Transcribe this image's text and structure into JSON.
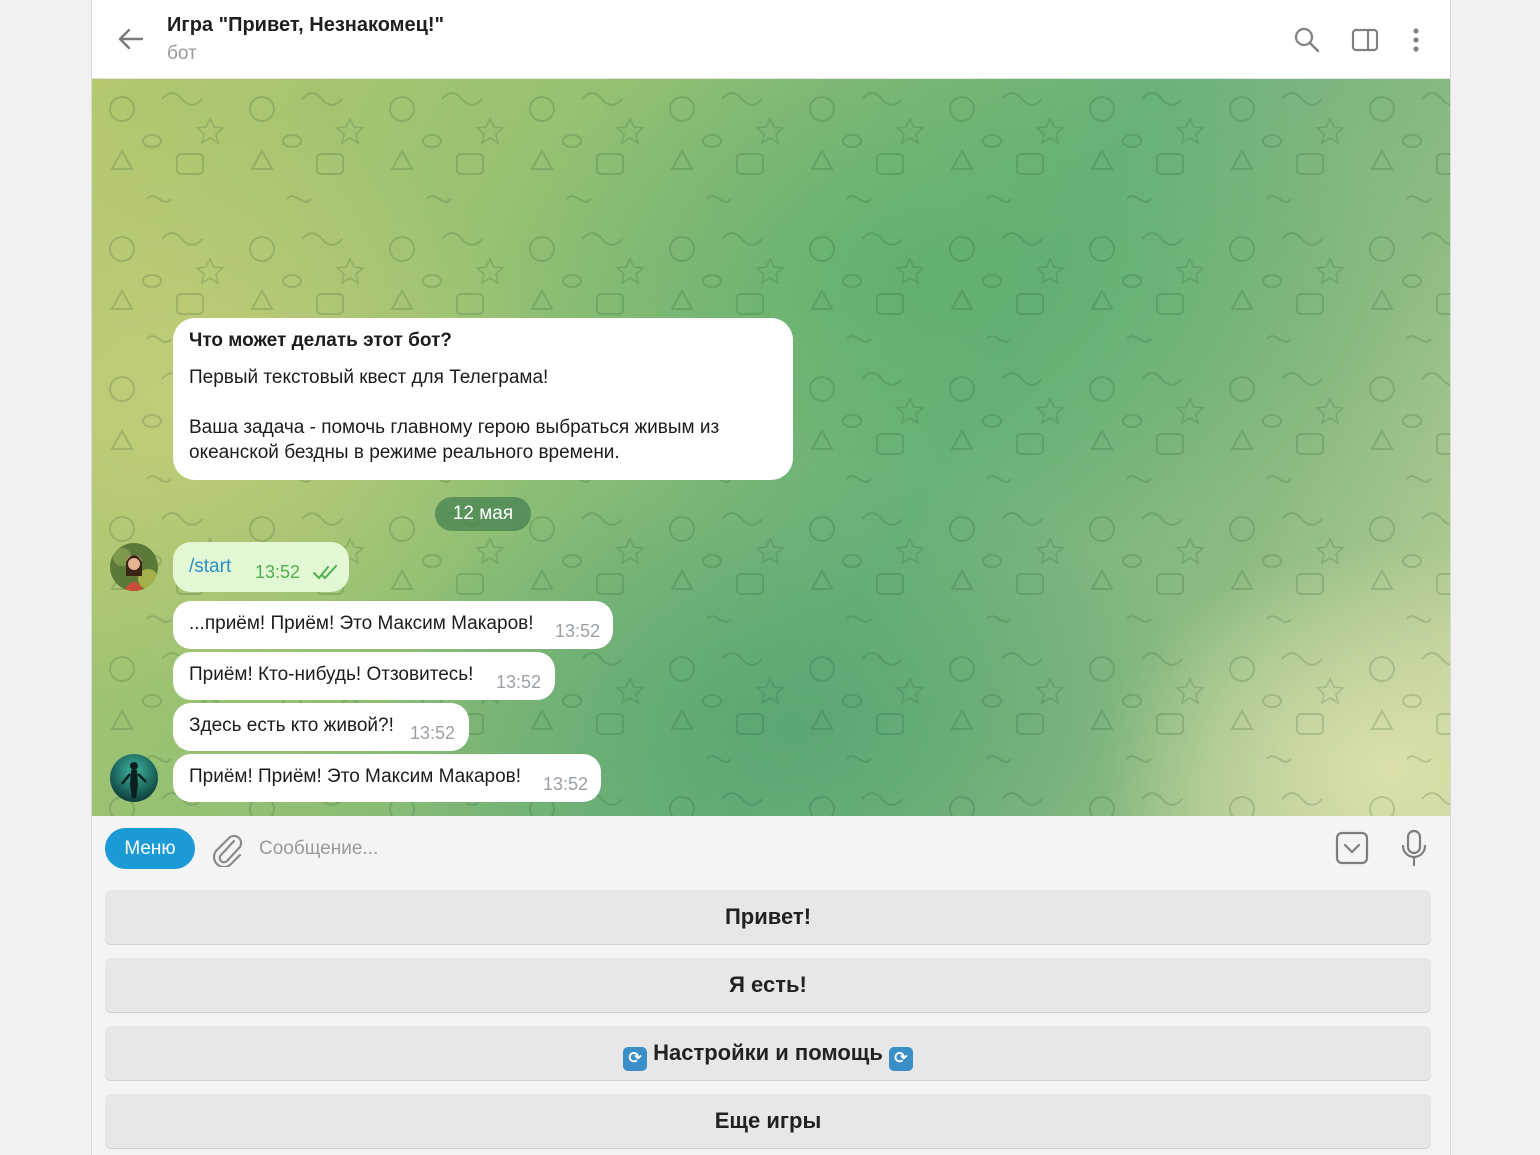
{
  "header": {
    "title": "Игра \"Привет, Незнакомец!\"",
    "subtitle": "бот"
  },
  "chat": {
    "info": {
      "question": "Что может делать этот бот?",
      "line1": "Первый текстовый квест для Телеграма!",
      "line2": "Ваша задача - помочь главному герою выбраться живым из океанской бездны в режиме реального времени."
    },
    "date": "12 мая",
    "outgoing": {
      "text": "/start",
      "time": "13:52"
    },
    "messages": [
      {
        "text": "...приём! Приём! Это Максим Макаров!",
        "time": "13:52"
      },
      {
        "text": "Приём! Кто-нибудь! Отзовитесь!",
        "time": "13:52"
      },
      {
        "text": "Здесь есть кто живой?!",
        "time": "13:52"
      },
      {
        "text": "Приём! Приём! Это Максим Макаров!",
        "time": "13:52"
      }
    ]
  },
  "input": {
    "menu_label": "Меню",
    "placeholder": "Сообщение..."
  },
  "keyboard": {
    "buttons": [
      "Привет!",
      "Я есть!",
      "Настройки и помощь",
      "Еще игры"
    ]
  },
  "colors": {
    "accent": "#1a9bd6",
    "outgoing_bubble": "#e2f8d4",
    "link": "#2a8fc7"
  }
}
